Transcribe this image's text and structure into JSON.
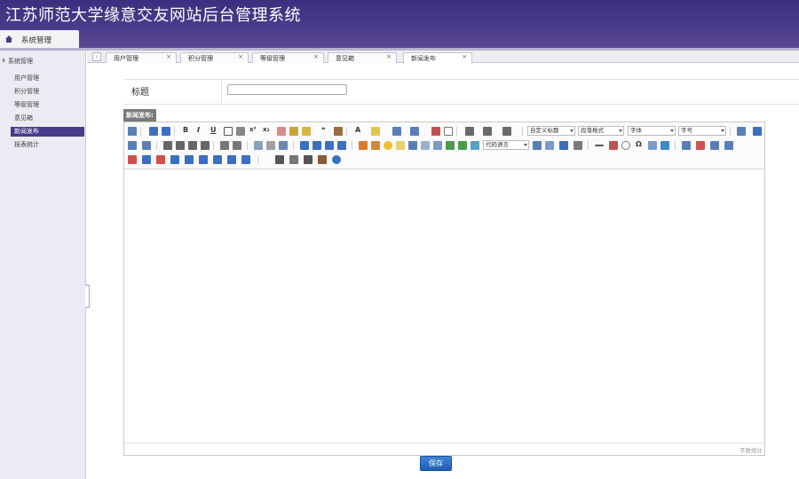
{
  "header": {
    "app_title": "江苏师范大学缘意交友网站后台管理系统",
    "module_tab": "系统管理"
  },
  "sidebar": {
    "group": "系统管理",
    "items": [
      {
        "label": "用户管理",
        "active": false
      },
      {
        "label": "积分管理",
        "active": false
      },
      {
        "label": "等级管理",
        "active": false
      },
      {
        "label": "意见箱",
        "active": false
      },
      {
        "label": "新闻发布",
        "active": true
      },
      {
        "label": "报表统计",
        "active": false
      }
    ]
  },
  "tabs": [
    {
      "label": "用户管理",
      "close": "×"
    },
    {
      "label": "积分管理",
      "close": "×"
    },
    {
      "label": "等级管理",
      "close": "×"
    },
    {
      "label": "意见箱",
      "close": "×"
    },
    {
      "label": "新闻发布",
      "close": "×",
      "active": true
    }
  ],
  "form": {
    "title_label": "标题",
    "title_value": "",
    "content_label": "新闻发布:",
    "save_label": "保存"
  },
  "editor": {
    "selects": {
      "code_lang": "代码语言",
      "custom_heading": "自定义标题",
      "paragraph_format": "段落格式",
      "font_family": "字体",
      "font_size": "字号"
    },
    "text_buttons": {
      "bold": "B",
      "italic": "I",
      "underline": "U",
      "font_color": "A",
      "superscript": "x²",
      "subscript": "x₂",
      "quote": "❝",
      "omega": "Ω"
    },
    "word_count": "字数统计"
  },
  "colors": {
    "header_bg": "#3a2f7e",
    "sidebar_active": "#4a3b8a",
    "save_button": "#2a6fc9"
  }
}
